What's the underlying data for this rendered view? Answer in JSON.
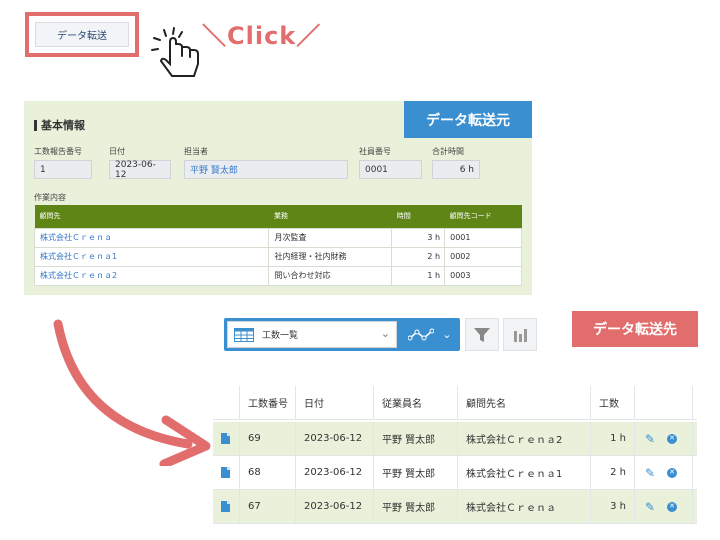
{
  "top": {
    "transfer_button": "データ転送",
    "click_text": "＼Click／"
  },
  "source": {
    "section_title": "基本情報",
    "badge": "データ転送元",
    "fields": {
      "report_no_label": "工数報告番号",
      "report_no": "1",
      "date_label": "日付",
      "date": "2023-06-12",
      "person_label": "担当者",
      "person": "平野 賢太郎",
      "employee_no_label": "社員番号",
      "employee_no": "0001",
      "total_time_label": "合計時間",
      "total_time": "6 h"
    },
    "work_label": "作業内容",
    "table": {
      "headers": [
        "顧問先",
        "業務",
        "時間",
        "顧問先コード"
      ],
      "rows": [
        [
          "株式会社Ｃｒｅｎａ",
          "月次監査",
          "3 h",
          "0001"
        ],
        [
          "株式会社Ｃｒｅｎａ1",
          "社内経理・社内財務",
          "2 h",
          "0002"
        ],
        [
          "株式会社Ｃｒｅｎａ2",
          "問い合わせ対応",
          "1 h",
          "0003"
        ]
      ]
    }
  },
  "destination": {
    "view_name": "工数一覧",
    "badge": "データ転送先",
    "table": {
      "headers": [
        "工数番号",
        "日付",
        "従業員名",
        "顧問先名",
        "工数"
      ],
      "rows": [
        [
          "69",
          "2023-06-12",
          "平野 賢太郎",
          "株式会社Ｃｒｅｎａ2",
          "1 h"
        ],
        [
          "68",
          "2023-06-12",
          "平野 賢太郎",
          "株式会社Ｃｒｅｎａ1",
          "2 h"
        ],
        [
          "67",
          "2023-06-12",
          "平野 賢太郎",
          "株式会社Ｃｒｅｎａ",
          "3 h"
        ]
      ]
    }
  },
  "colors": {
    "accent_red": "#e26d6d",
    "accent_blue": "#3a8fd1",
    "header_green": "#5f8516",
    "panel_green": "#e9f1da"
  }
}
